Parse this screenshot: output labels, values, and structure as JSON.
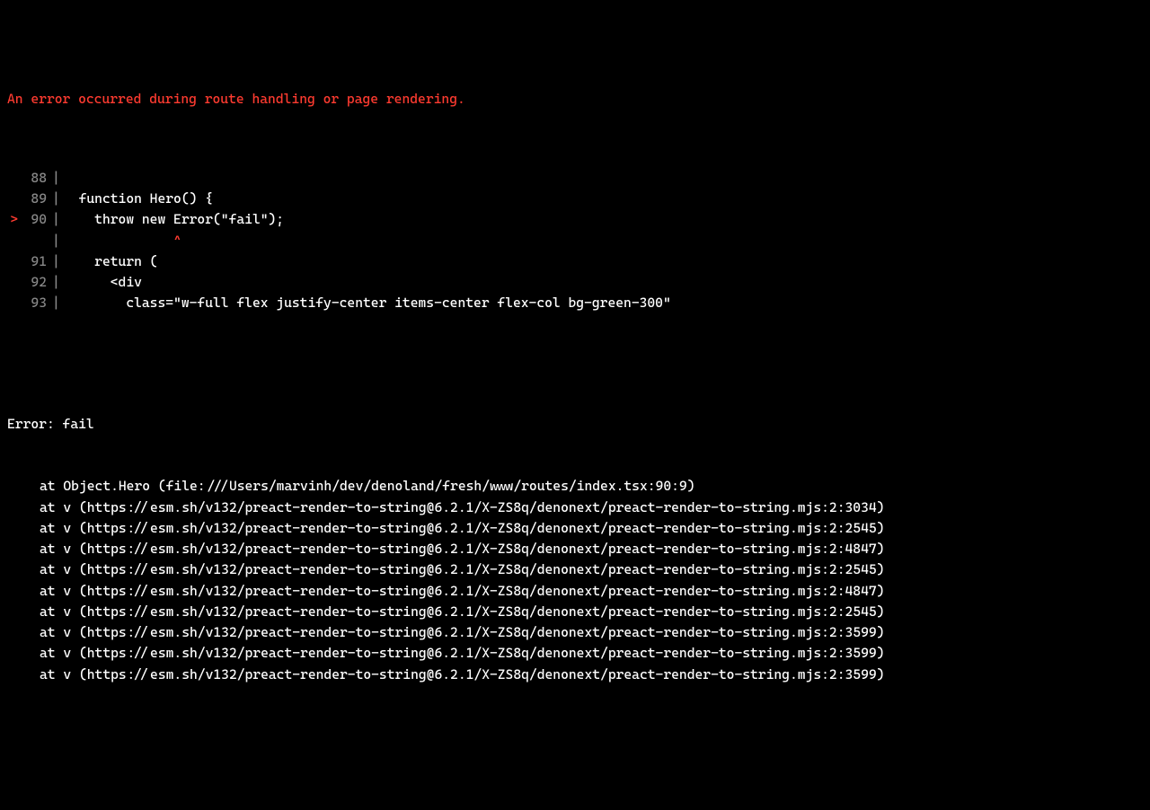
{
  "error_header": "An error occurred during route handling or page rendering.",
  "code": {
    "lines": [
      {
        "marker": " ",
        "num": "88",
        "text": ""
      },
      {
        "marker": " ",
        "num": "89",
        "text": "  function Hero() {"
      },
      {
        "marker": ">",
        "num": "90",
        "text": "    throw new Error(\"fail\");"
      },
      {
        "marker": " ",
        "num": "",
        "text": "",
        "caret": "              ^"
      },
      {
        "marker": " ",
        "num": "91",
        "text": "    return ("
      },
      {
        "marker": " ",
        "num": "92",
        "text": "      <div"
      },
      {
        "marker": " ",
        "num": "93",
        "text": "        class=\"w-full flex justify-center items-center flex-col bg-green-300\""
      }
    ]
  },
  "stack": {
    "error_line": "Error: fail",
    "frames": [
      "at Object.Hero (file:///Users/marvinh/dev/denoland/fresh/www/routes/index.tsx:90:9)",
      "at v (https://esm.sh/v132/preact-render-to-string@6.2.1/X-ZS8q/denonext/preact-render-to-string.mjs:2:3034)",
      "at v (https://esm.sh/v132/preact-render-to-string@6.2.1/X-ZS8q/denonext/preact-render-to-string.mjs:2:2545)",
      "at v (https://esm.sh/v132/preact-render-to-string@6.2.1/X-ZS8q/denonext/preact-render-to-string.mjs:2:4847)",
      "at v (https://esm.sh/v132/preact-render-to-string@6.2.1/X-ZS8q/denonext/preact-render-to-string.mjs:2:2545)",
      "at v (https://esm.sh/v132/preact-render-to-string@6.2.1/X-ZS8q/denonext/preact-render-to-string.mjs:2:4847)",
      "at v (https://esm.sh/v132/preact-render-to-string@6.2.1/X-ZS8q/denonext/preact-render-to-string.mjs:2:2545)",
      "at v (https://esm.sh/v132/preact-render-to-string@6.2.1/X-ZS8q/denonext/preact-render-to-string.mjs:2:3599)",
      "at v (https://esm.sh/v132/preact-render-to-string@6.2.1/X-ZS8q/denonext/preact-render-to-string.mjs:2:3599)",
      "at v (https://esm.sh/v132/preact-render-to-string@6.2.1/X-ZS8q/denonext/preact-render-to-string.mjs:2:3599)"
    ]
  }
}
